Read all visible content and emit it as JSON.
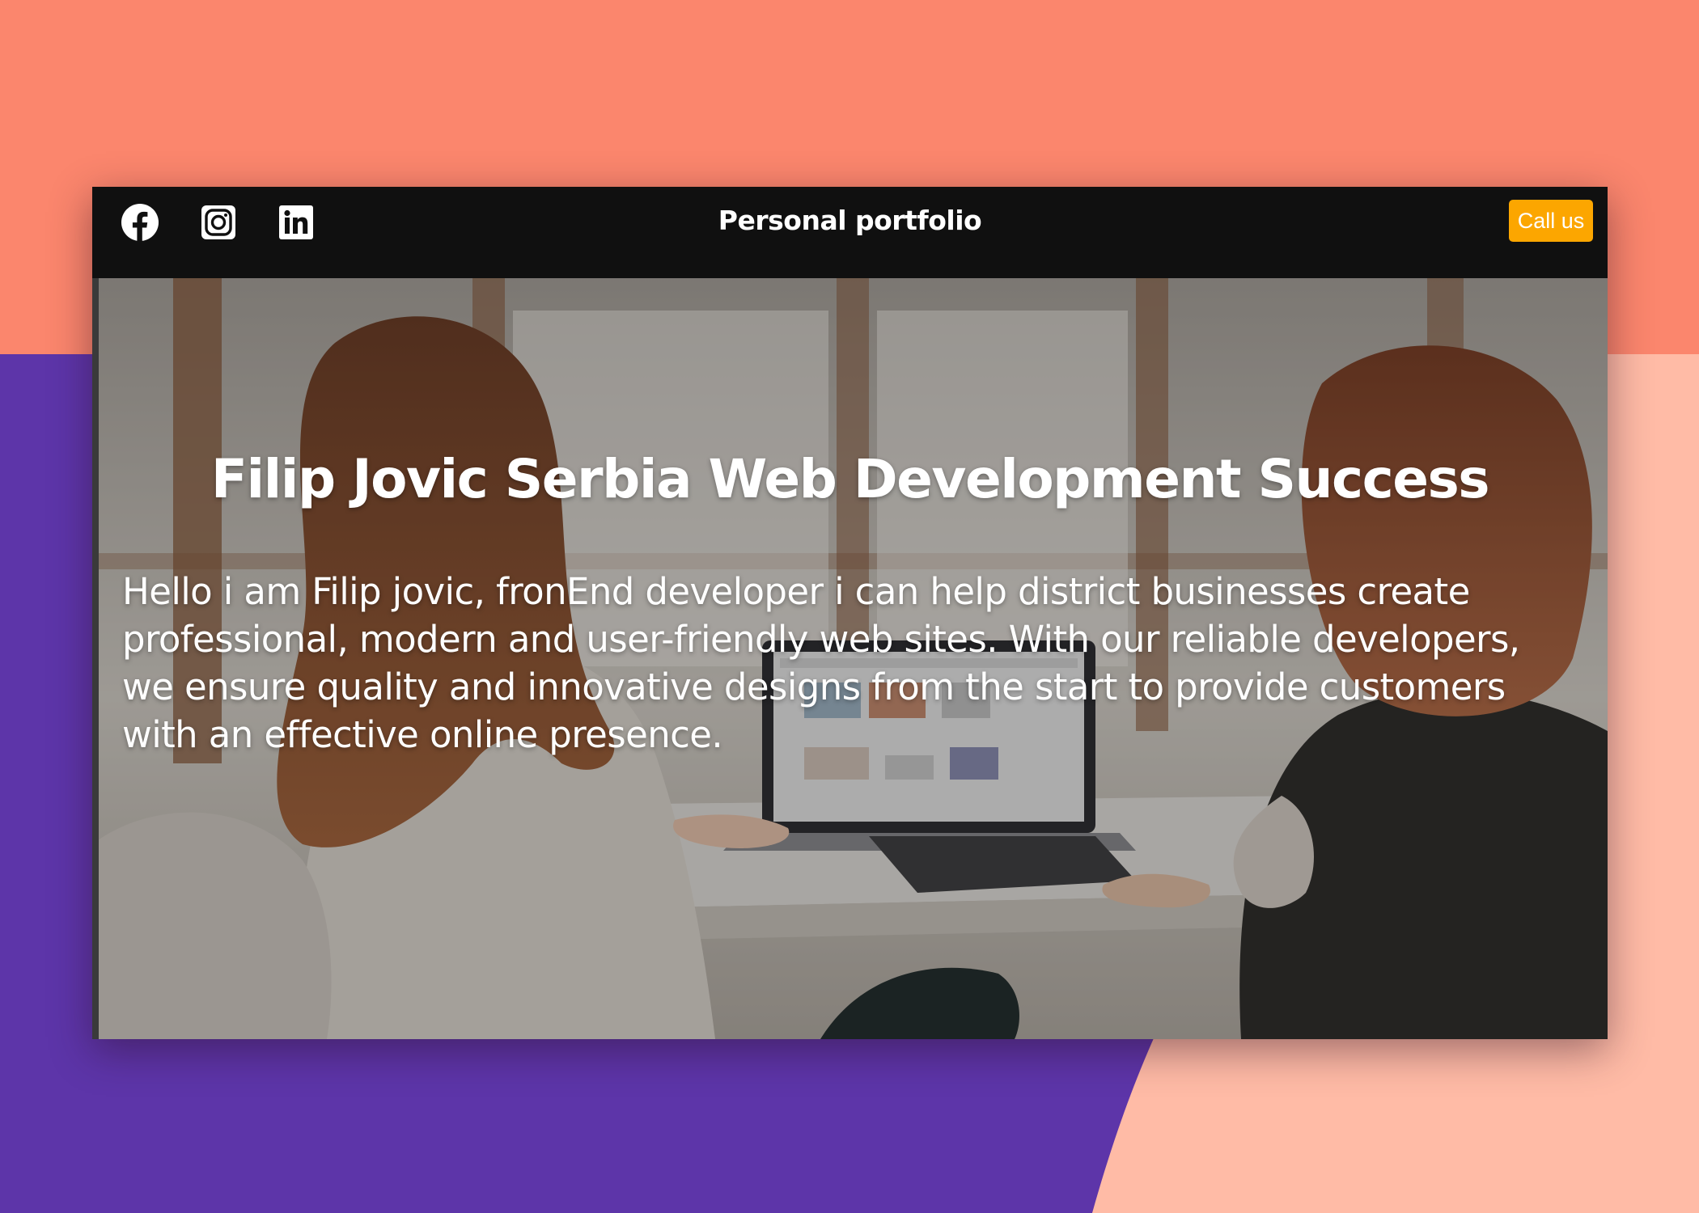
{
  "background": {
    "colors": {
      "coral": "#fb866d",
      "purple": "#5d35a9",
      "peach": "#ffbba6"
    }
  },
  "navbar": {
    "title": "Personal portfolio",
    "social": [
      {
        "icon": "facebook-icon"
      },
      {
        "icon": "instagram-icon"
      },
      {
        "icon": "linkedin-icon"
      }
    ],
    "cta_label": "Call us",
    "cta_color": "#fca600"
  },
  "hero": {
    "heading": "Filip Jovic Serbia Web Development Success",
    "body": "Hello i am Filip jovic, fronEnd developer i can help district businesses create professional, modern and user-friendly web sites. With our reliable developers, we ensure quality and innovative designs from the start to provide customers with an effective online presence."
  }
}
